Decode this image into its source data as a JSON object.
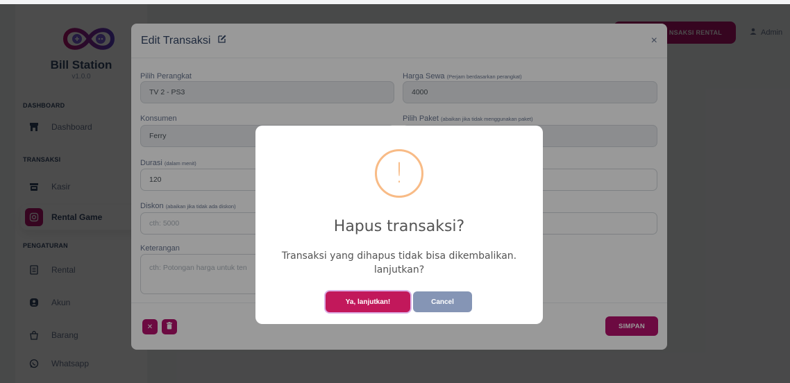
{
  "app": {
    "name": "Bill Station",
    "version": "v1.0.0"
  },
  "sidebar": {
    "sections": [
      {
        "title": "DASHBOARD",
        "items": [
          {
            "label": "Dashboard",
            "icon": "store-icon"
          }
        ]
      },
      {
        "title": "TRANSAKSI",
        "items": [
          {
            "label": "Kasir",
            "icon": "cash-register-icon"
          },
          {
            "label": "Rental Game",
            "icon": "gamepad-icon",
            "active": true
          }
        ]
      },
      {
        "title": "PENGATURAN",
        "items": [
          {
            "label": "Rental",
            "icon": "list-icon"
          },
          {
            "label": "Akun",
            "icon": "user-circle-icon"
          },
          {
            "label": "Barang",
            "icon": "bag-icon"
          },
          {
            "label": "Whatsapp",
            "icon": "whatsapp-icon"
          }
        ]
      }
    ]
  },
  "topbar": {
    "rental_button": "NSAKSI RENTAL",
    "user_name": "Admin"
  },
  "edit_modal": {
    "title": "Edit Transaksi",
    "fields": {
      "perangkat": {
        "label": "Pilih Perangkat",
        "value": "TV 2 - PS3"
      },
      "harga_sewa": {
        "label": "Harga Sewa",
        "hint": "(Perjam berdasarkan perangkat)",
        "value": "4000"
      },
      "konsumen": {
        "label": "Konsumen",
        "value": "Ferry"
      },
      "paket": {
        "label": "Pilih Paket",
        "hint": "(abaikan jika tidak menggunakan paket)",
        "value": ""
      },
      "durasi": {
        "label": "Durasi",
        "hint": "(dalam menit)",
        "value": "120"
      },
      "diskon": {
        "label": "Diskon",
        "hint": "(abaikan jika tidak ada diskon)",
        "placeholder": "cth: 5000"
      },
      "keterangan": {
        "label": "Keterangan",
        "placeholder": "cth: Potongan harga untuk ten"
      }
    },
    "save_button": "SIMPAN",
    "close_symbol": "×"
  },
  "confirm_dialog": {
    "icon_symbol": "!",
    "title": "Hapus transaksi?",
    "message": "Transaksi yang dihapus tidak bisa dikembalikan. lanjutkan?",
    "confirm_button": "Ya, lanjutkan!",
    "cancel_button": "Cancel"
  },
  "colors": {
    "brand": "#b4126d",
    "confirm": "#c2185b",
    "cancel": "#8595b5",
    "warning": "#f8bb86"
  }
}
